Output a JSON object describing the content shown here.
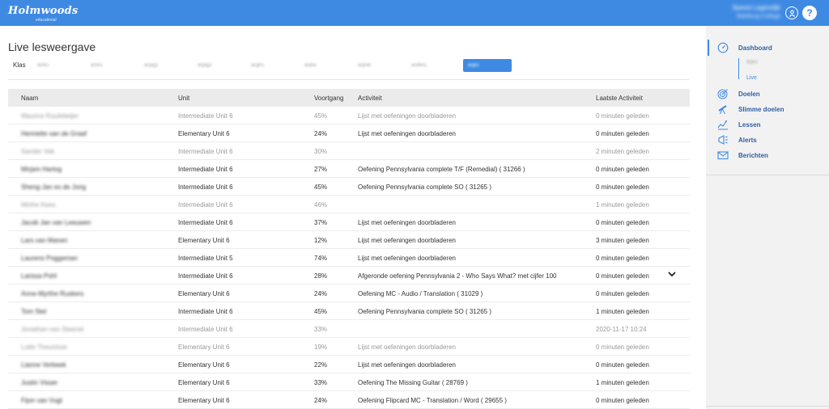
{
  "header": {
    "logo": "Holmwoods",
    "logo_sub": "educational",
    "user_name": "Speed Lagendijk",
    "user_org": "Wartburg College"
  },
  "page": {
    "title": "Live lesweergave",
    "klas_label": "Klas",
    "class_tabs": [
      "acfe1",
      "acfe2",
      "acjag1",
      "acjag2",
      "acgh1",
      "acjha",
      "acjhat",
      "acdke1",
      "acjk2"
    ],
    "active_tab_index": 8
  },
  "table": {
    "headers": [
      "Naam",
      "Unit",
      "Voortgang",
      "Activiteit",
      "Laatste Activiteit"
    ],
    "rows": [
      {
        "name": "Maurice Ruulebeijer",
        "unit": "Intermediate Unit 6",
        "progress": "45%",
        "activity": "Lijst met oefeningen doorbladeren",
        "last": "0 minuten geleden",
        "dim": true
      },
      {
        "name": "Henriette van de Graaf",
        "unit": "Elementary Unit 6",
        "progress": "24%",
        "activity": "Lijst met oefeningen doorbladeren",
        "last": "0 minuten geleden",
        "dim": false
      },
      {
        "name": "Sander Vak",
        "unit": "Intermediate Unit 6",
        "progress": "30%",
        "activity": "",
        "last": "2 minuten geleden",
        "dim": true
      },
      {
        "name": "Mirjam Hartog",
        "unit": "Intermediate Unit 6",
        "progress": "27%",
        "activity": "Oefening Pennsylvania complete T/F (Remedial) ( 31266 )",
        "last": "0 minuten geleden",
        "dim": false
      },
      {
        "name": "Sheng-Jan es de Jong",
        "unit": "Intermediate Unit 6",
        "progress": "45%",
        "activity": "Oefening Pennsylvania complete SO ( 31265 )",
        "last": "0 minuten geleden",
        "dim": false
      },
      {
        "name": "Mirthe Kees",
        "unit": "Intermediate Unit 6",
        "progress": "46%",
        "activity": "",
        "last": "1 minuten geleden",
        "dim": true
      },
      {
        "name": "Jacob Jan van Leeuwen",
        "unit": "Intermediate Unit 6",
        "progress": "37%",
        "activity": "Lijst met oefeningen doorbladeren",
        "last": "0 minuten geleden",
        "dim": false
      },
      {
        "name": "Lars van Manen",
        "unit": "Elementary Unit 6",
        "progress": "12%",
        "activity": "Lijst met oefeningen doorbladeren",
        "last": "3 minuten geleden",
        "dim": false
      },
      {
        "name": "Laurens Poggeman",
        "unit": "Intermediate Unit 5",
        "progress": "74%",
        "activity": "Lijst met oefeningen doorbladeren",
        "last": "0 minuten geleden",
        "dim": false
      },
      {
        "name": "Larissa Pohl",
        "unit": "Intermediate Unit 6",
        "progress": "28%",
        "activity": "Afgeronde oefening Pennsylvania 2 - Who Says What? met cijfer 100",
        "last": "0 minuten geleden",
        "dim": false,
        "chevron": true
      },
      {
        "name": "Anne-Myrthe Ruskers",
        "unit": "Elementary Unit 6",
        "progress": "24%",
        "activity": "Oefening MC - Audio / Translation ( 31029 )",
        "last": "0 minuten geleden",
        "dim": false
      },
      {
        "name": "Tom Stel",
        "unit": "Intermediate Unit 6",
        "progress": "45%",
        "activity": "Oefening Pennsylvania complete SO ( 31265 )",
        "last": "1 minuten geleden",
        "dim": false
      },
      {
        "name": "Jonathan van Steenel",
        "unit": "Intermediate Unit 6",
        "progress": "33%",
        "activity": "",
        "last": "2020-11-17 10:24",
        "dim": true
      },
      {
        "name": "Lotte Theunisse",
        "unit": "Elementary Unit 6",
        "progress": "19%",
        "activity": "Lijst met oefeningen doorbladeren",
        "last": "0 minuten geleden",
        "dim": true
      },
      {
        "name": "Lianne Verbeek",
        "unit": "Elementary Unit 6",
        "progress": "22%",
        "activity": "Lijst met oefeningen doorbladeren",
        "last": "0 minuten geleden",
        "dim": false
      },
      {
        "name": "Justin Visser",
        "unit": "Elementary Unit 6",
        "progress": "33%",
        "activity": "Oefening The Missing Guitar ( 28769 )",
        "last": "1 minuten geleden",
        "dim": false
      },
      {
        "name": "Fijon van Vugt",
        "unit": "Elementary Unit 6",
        "progress": "24%",
        "activity": "Oefening Flipcard MC - Translation / Word ( 29655 )",
        "last": "0 minuten geleden",
        "dim": false
      }
    ]
  },
  "sidebar": {
    "items": [
      {
        "label": "Dashboard",
        "icon": "gauge-icon"
      },
      {
        "label": "Doelen",
        "icon": "target-icon"
      },
      {
        "label": "Slimme doelen",
        "icon": "telescope-icon"
      },
      {
        "label": "Lessen",
        "icon": "chart-icon"
      },
      {
        "label": "Alerts",
        "icon": "megaphone-icon"
      },
      {
        "label": "Berichten",
        "icon": "envelope-icon"
      }
    ],
    "sub_blurred": "acjk2",
    "sub_live": "Live"
  },
  "colors": {
    "accent": "#3e8ae3",
    "nav_text": "#2f5fa8"
  }
}
